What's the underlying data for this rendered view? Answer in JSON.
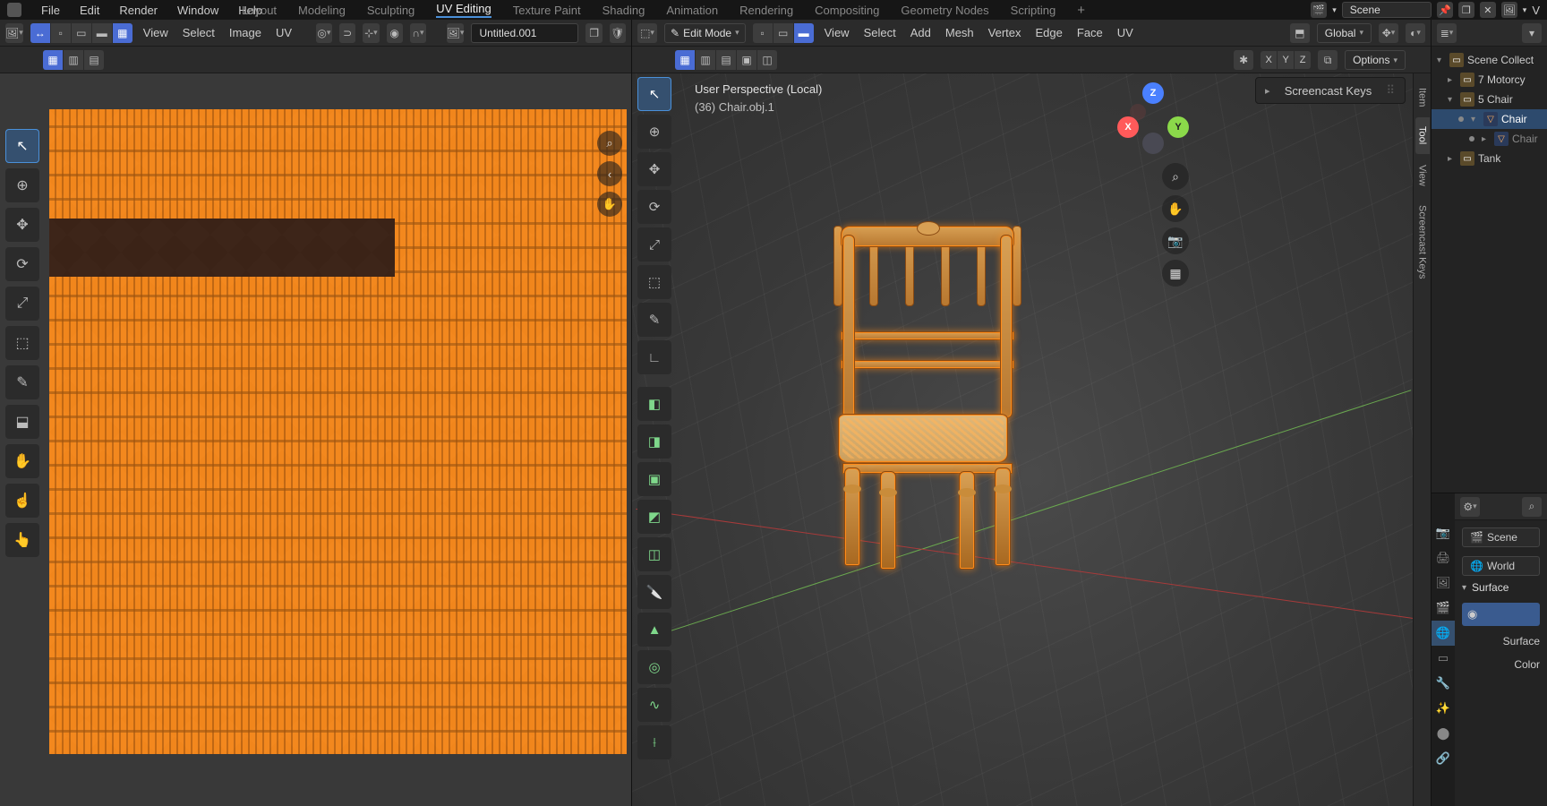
{
  "top_menu": {
    "file": "File",
    "edit": "Edit",
    "render": "Render",
    "window": "Window",
    "help": "Help"
  },
  "workspaces": {
    "items": [
      "Layout",
      "Modeling",
      "Sculpting",
      "UV Editing",
      "Texture Paint",
      "Shading",
      "Animation",
      "Rendering",
      "Compositing",
      "Geometry Nodes",
      "Scripting"
    ],
    "active": "UV Editing",
    "add": "+"
  },
  "scene_name": "Scene",
  "uv_header": {
    "view": "View",
    "select": "Select",
    "image": "Image",
    "uv": "UV",
    "image_name": "Untitled.001"
  },
  "viewport_header": {
    "mode": "Edit Mode",
    "view": "View",
    "select": "Select",
    "add": "Add",
    "mesh": "Mesh",
    "vertex": "Vertex",
    "edge": "Edge",
    "face": "Face",
    "uv": "UV",
    "orientation": "Global",
    "options": "Options"
  },
  "axis_chips": [
    "X",
    "Y",
    "Z"
  ],
  "overlay": {
    "perspective": "User Perspective (Local)",
    "object": "(36) Chair.obj.1"
  },
  "nav_gizmo": {
    "x": "X",
    "y": "Y",
    "z": "Z"
  },
  "screencast": {
    "title": "Screencast Keys"
  },
  "vtabs": {
    "item": "Item",
    "tool": "Tool",
    "view": "View",
    "screencast": "Screencast Keys"
  },
  "outliner": {
    "scene_collection": "Scene Collect",
    "items": [
      {
        "type": "coll",
        "label": "7 Motorcy",
        "indent": 1,
        "tw": "▸"
      },
      {
        "type": "coll",
        "label": "5 Chair",
        "indent": 1,
        "tw": "▾"
      },
      {
        "type": "obj",
        "label": "Chair",
        "indent": 2,
        "tw": "▾",
        "sel": true
      },
      {
        "type": "obj",
        "label": "Chair",
        "indent": 3,
        "tw": "▸",
        "dim": true
      },
      {
        "type": "coll",
        "label": "Tank",
        "indent": 1,
        "tw": "▸"
      }
    ]
  },
  "properties": {
    "breadcrumb_scene": "Scene",
    "breadcrumb_world": "World",
    "section_surface": "Surface",
    "label_surface": "Surface",
    "label_color": "Color"
  },
  "icons": {
    "search": "⌕",
    "gear": "⚙",
    "cursor": "↖",
    "circle": "◯",
    "move": "✥",
    "rotate": "⟳",
    "scale": "⤢",
    "transform": "⬚",
    "annotate": "✎",
    "measure": "∟",
    "addcube": "◧",
    "zoom": "⌕",
    "hand": "✋",
    "camera": "📷",
    "grid": "▦",
    "magnet": "⊃",
    "snap": "▾",
    "pivot": "•",
    "shield": "⛉",
    "link": "🔗",
    "chevron": "▾",
    "chevron_r": "▸",
    "dots": "⠿",
    "butterfly": "✱",
    "sphere": "◉",
    "record": "⏺",
    "wf": "▢",
    "solid": "▣",
    "mat": "◐",
    "rend": "◉"
  }
}
